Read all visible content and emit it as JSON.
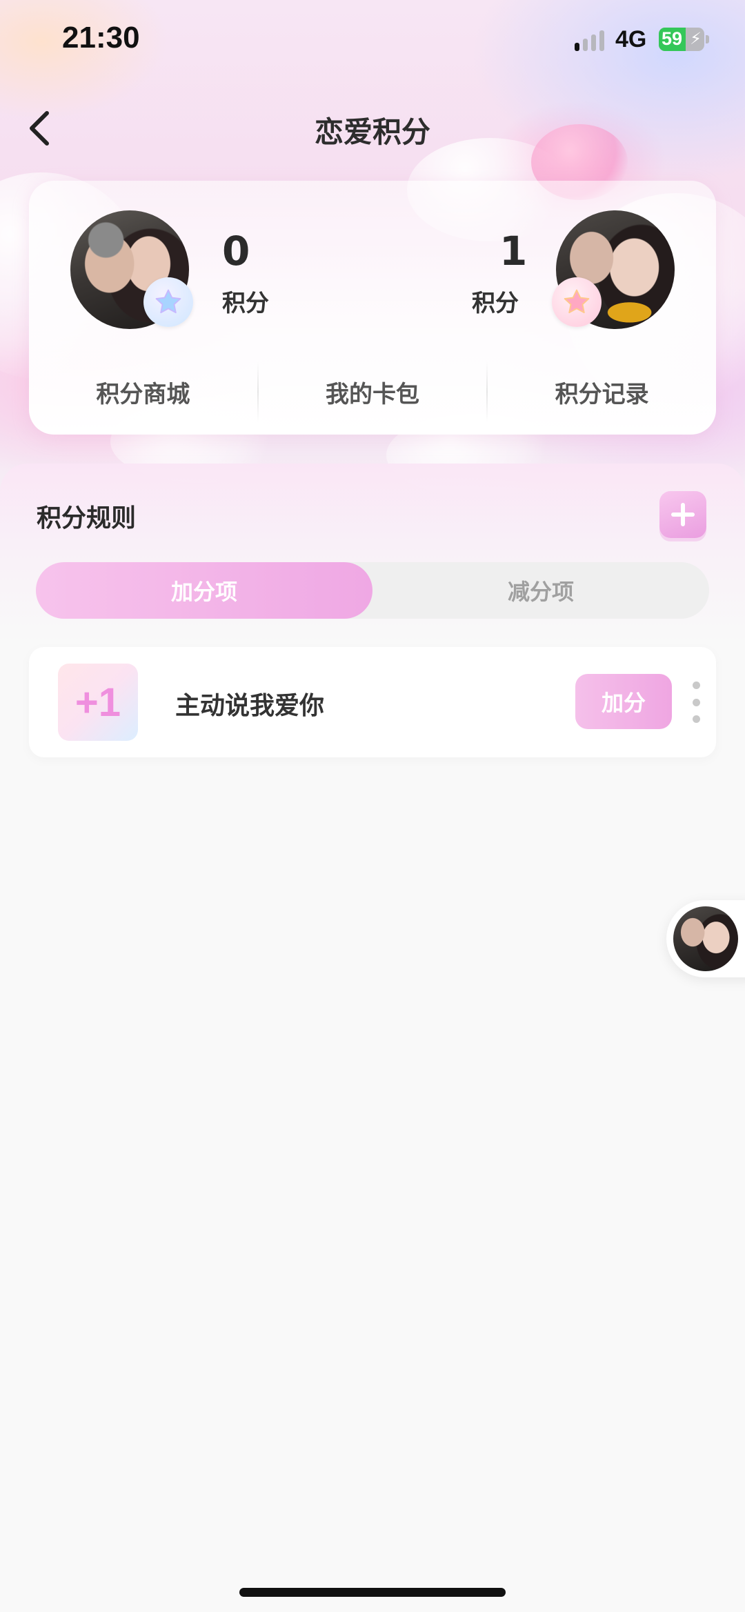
{
  "status_bar": {
    "time": "21:30",
    "network": "4G",
    "battery_percent": "59",
    "battery_level": 0.59,
    "charging_icon": "bolt-icon"
  },
  "nav": {
    "title": "恋爱积分",
    "back_icon": "chevron-left-icon"
  },
  "score_card": {
    "left_user": {
      "score": "0",
      "score_label": "积分",
      "badge_icon": "star-icon",
      "badge_color": "#a8d4ff"
    },
    "right_user": {
      "score": "1",
      "score_label": "积分",
      "badge_icon": "star-icon",
      "badge_color": "#ffa8c2"
    },
    "links": [
      {
        "label": "积分商城"
      },
      {
        "label": "我的卡包"
      },
      {
        "label": "积分记录"
      }
    ]
  },
  "rules": {
    "title": "积分规则",
    "add_icon": "plus-icon",
    "tabs": [
      {
        "label": "加分项",
        "active": true
      },
      {
        "label": "减分项",
        "active": false
      }
    ],
    "items": [
      {
        "points": "+1",
        "name": "主动说我爱你",
        "action_label": "加分",
        "more_icon": "more-vertical-icon"
      }
    ]
  },
  "colors": {
    "accent_pink": "#efa8e4",
    "points_text": "#ef8fde",
    "inactive_tab_text": "#a0a0a0"
  }
}
